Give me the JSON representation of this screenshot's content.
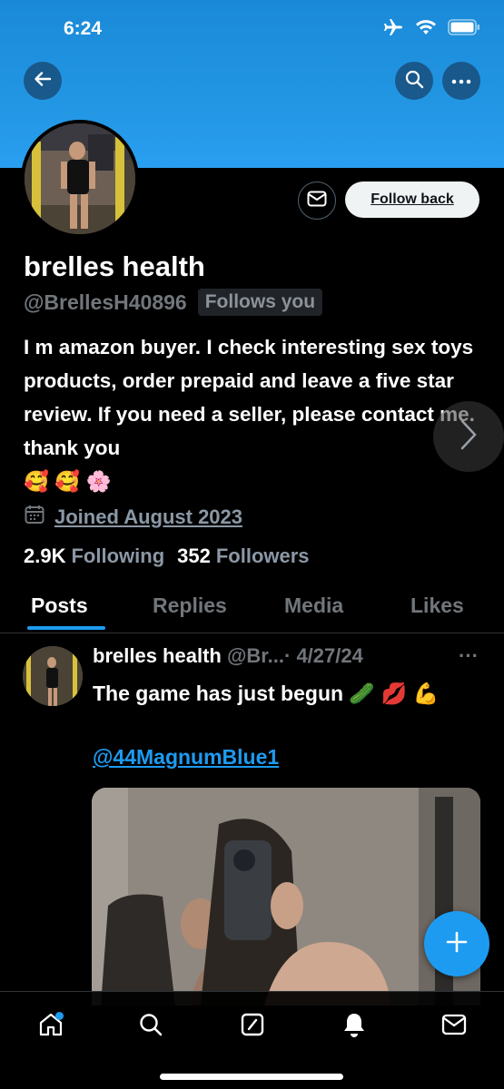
{
  "status_bar": {
    "time": "6:24"
  },
  "colors": {
    "accent": "#1d9bf0",
    "banner": "#2296e3",
    "muted": "#71767b"
  },
  "profile": {
    "name": "brelles health",
    "handle": "@BrellesH40896",
    "follows_you": "Follows you",
    "follow_back_label": "Follow back",
    "bio": "I m amazon buyer. I check interesting sex toys products, order prepaid and leave a five star review. If you need a seller, please contact me. thank you",
    "bio_emoji": "🥰 🥰 🌸",
    "joined": "Joined August 2023",
    "following_count": "2.9K",
    "following_label": "Following",
    "followers_count": "352",
    "followers_label": "Followers"
  },
  "tabs": [
    {
      "label": "Posts",
      "active": true
    },
    {
      "label": "Replies",
      "active": false
    },
    {
      "label": "Media",
      "active": false
    },
    {
      "label": "Likes",
      "active": false
    }
  ],
  "post": {
    "author": "brelles health",
    "handle": "@Br...",
    "date": "· 4/27/24",
    "more": "···",
    "text": "The game has just begun 🥒 💋 💪",
    "mention": "@44MagnumBlue1"
  },
  "icons": {
    "back": "back-arrow-icon",
    "search": "search-icon",
    "more": "more-icon",
    "mail": "mail-icon",
    "calendar": "calendar-icon",
    "compose": "plus-icon"
  },
  "bottom_nav": [
    "home-icon",
    "search-icon",
    "grok-icon",
    "notifications-icon",
    "messages-icon"
  ]
}
